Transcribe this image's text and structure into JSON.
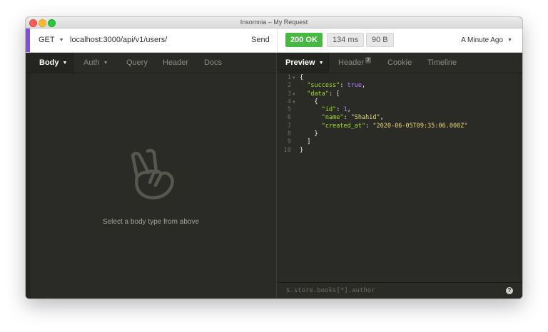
{
  "window": {
    "title": "Insomnia – My Request"
  },
  "request": {
    "method": "GET",
    "url": "localhost:3000/api/v1/users/",
    "send_label": "Send"
  },
  "response_meta": {
    "status": "200 OK",
    "time": "134 ms",
    "size": "90 B",
    "time_ago": "A Minute Ago",
    "status_color": "#49b842"
  },
  "left_tabs": {
    "body": "Body",
    "auth": "Auth",
    "query": "Query",
    "header": "Header",
    "docs": "Docs"
  },
  "left_pane": {
    "empty_message": "Select a body type from above",
    "icon": "peace-hand-icon"
  },
  "right_tabs": {
    "preview": "Preview",
    "header": "Header",
    "header_count": "2",
    "cookie": "Cookie",
    "timeline": "Timeline"
  },
  "response_body": {
    "line_numbers": [
      "1",
      "2",
      "3",
      "4",
      "5",
      "6",
      "7",
      "8",
      "9",
      "10"
    ],
    "lines": [
      {
        "ind": "",
        "k": "",
        "p": "{",
        "v": "",
        "t": "",
        "tail": ""
      },
      {
        "ind": "  ",
        "k": "\"success\"",
        "p": ": ",
        "v": "true",
        "t": "b",
        "tail": ","
      },
      {
        "ind": "  ",
        "k": "\"data\"",
        "p": ": [",
        "v": "",
        "t": "",
        "tail": ""
      },
      {
        "ind": "    ",
        "k": "",
        "p": "{",
        "v": "",
        "t": "",
        "tail": ""
      },
      {
        "ind": "      ",
        "k": "\"id\"",
        "p": ": ",
        "v": "1",
        "t": "n",
        "tail": ","
      },
      {
        "ind": "      ",
        "k": "\"name\"",
        "p": ": ",
        "v": "\"Shahid\"",
        "t": "s",
        "tail": ","
      },
      {
        "ind": "      ",
        "k": "\"created_at\"",
        "p": ": ",
        "v": "\"2020-06-05T09:35:06.000Z\"",
        "t": "s",
        "tail": ""
      },
      {
        "ind": "    ",
        "k": "",
        "p": "}",
        "v": "",
        "t": "",
        "tail": ""
      },
      {
        "ind": "  ",
        "k": "",
        "p": "]",
        "v": "",
        "t": "",
        "tail": ""
      },
      {
        "ind": "",
        "k": "",
        "p": "}",
        "v": "",
        "t": "",
        "tail": ""
      }
    ]
  },
  "filter": {
    "placeholder": "$.store.books[*].author",
    "help_icon": "?"
  }
}
